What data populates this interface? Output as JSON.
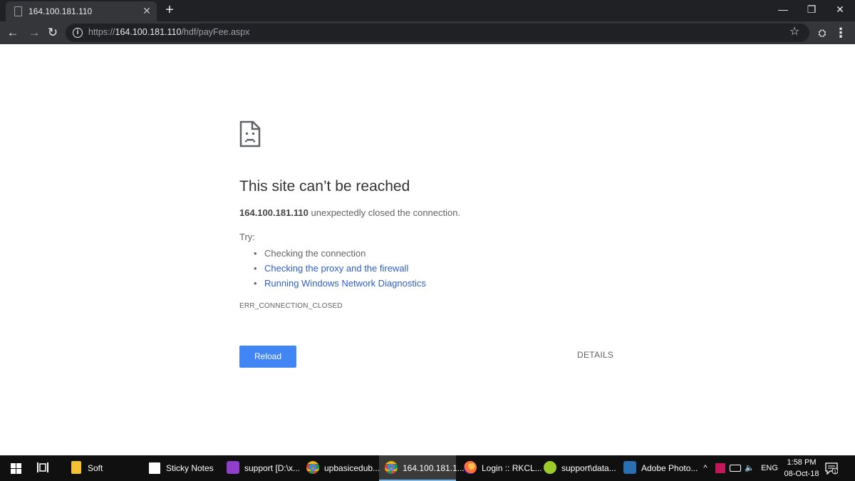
{
  "browser": {
    "tab": {
      "title": "164.100.181.110",
      "close_glyph": "✕"
    },
    "newtab_glyph": "+",
    "window_controls": {
      "minimize": "—",
      "restore": "❐",
      "close": "✕"
    },
    "nav": {
      "back": "←",
      "forward": "→",
      "reload": "↻"
    },
    "address": {
      "scheme": "https://",
      "host": "164.100.181.110",
      "path": "/hdf/payFee.aspx",
      "info_glyph": "i"
    },
    "star_glyph": "☆",
    "menu_glyph": "⋮",
    "ext_glyph": "⛭"
  },
  "error_page": {
    "title": "This site can’t be reached",
    "host_bold": "164.100.181.110",
    "message": " unexpectedly closed the connection.",
    "try_label": "Try:",
    "suggestions": [
      {
        "text": "Checking the connection",
        "link": false
      },
      {
        "text": "Checking the proxy and the firewall",
        "link": true
      },
      {
        "text": "Running Windows Network Diagnostics",
        "link": true
      }
    ],
    "error_code": "ERR_CONNECTION_CLOSED",
    "reload_label": "Reload",
    "details_label": "DETAILS"
  },
  "taskbar": {
    "items": [
      {
        "label": "Soft",
        "icon": "folder-icon",
        "color": "#f2c233",
        "active": false
      },
      {
        "label": "Sticky Notes",
        "icon": "sticky-notes-icon",
        "color": "#ffffff",
        "active": false
      },
      {
        "label": "support [D:\\x...",
        "icon": "phpstorm-icon",
        "color": "#8f3fc9",
        "active": false
      },
      {
        "label": "upbasicedub...",
        "icon": "chrome-icon",
        "color": "#db4437",
        "active": false
      },
      {
        "label": "164.100.181.1...",
        "icon": "chrome-icon",
        "color": "#db4437",
        "active": true
      },
      {
        "label": "Login :: RKCL...",
        "icon": "firefox-icon",
        "color": "#ff7139",
        "active": false
      },
      {
        "label": "support\\data...",
        "icon": "heidisql-icon",
        "color": "#9ccc2a",
        "active": false
      },
      {
        "label": "Adobe Photo...",
        "icon": "photoshop-icon",
        "color": "#2a6fb0",
        "active": false
      }
    ],
    "tray": {
      "chevron": "^",
      "language": "ENG",
      "volume_glyph": "🔈",
      "time": "1:58 PM",
      "date": "08-Oct-18",
      "notification_count": "1"
    }
  }
}
